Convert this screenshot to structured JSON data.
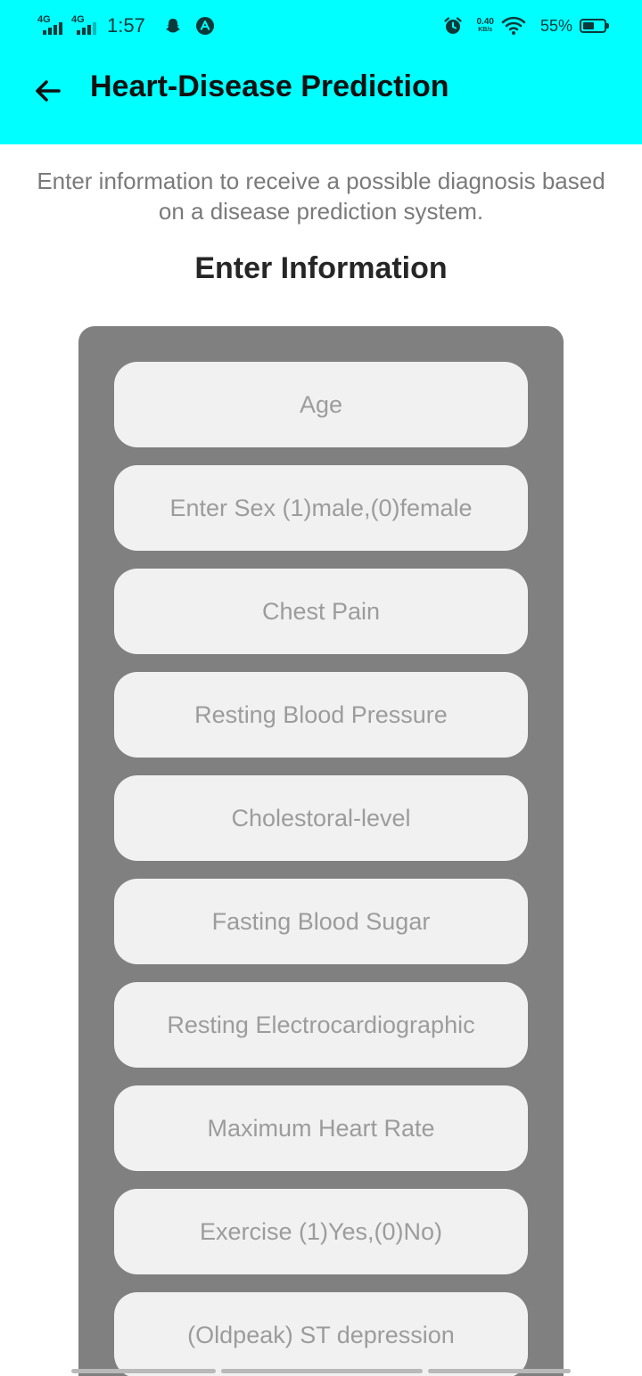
{
  "status_bar": {
    "network_1": "4G",
    "network_2": "4G",
    "time": "1:57",
    "speed_value": "0.40",
    "speed_unit": "KB/s",
    "battery_percent": "55%",
    "battery_level": 0.55,
    "icons": [
      "signal-icon",
      "snapchat-icon",
      "app-notification-icon",
      "alarm-icon",
      "wifi-icon",
      "battery-icon"
    ]
  },
  "app_bar": {
    "title": "Heart-Disease Prediction",
    "back_icon": "arrow-left-icon",
    "background": "#00ffff"
  },
  "main": {
    "intro": "Enter information to receive a possible diagnosis based on a disease prediction system.",
    "section_title": "Enter Information"
  },
  "form": {
    "card_color": "#808080",
    "fields": [
      {
        "placeholder": "Age",
        "value": ""
      },
      {
        "placeholder": "Enter Sex (1)male,(0)female",
        "value": ""
      },
      {
        "placeholder": "Chest Pain",
        "value": ""
      },
      {
        "placeholder": "Resting Blood Pressure",
        "value": ""
      },
      {
        "placeholder": "Cholestoral-level",
        "value": ""
      },
      {
        "placeholder": "Fasting Blood Sugar",
        "value": ""
      },
      {
        "placeholder": "Resting Electrocardiographic",
        "value": ""
      },
      {
        "placeholder": "Maximum Heart Rate",
        "value": ""
      },
      {
        "placeholder": "Exercise (1)Yes,(0)No)",
        "value": ""
      },
      {
        "placeholder": "(Oldpeak) ST depression",
        "value": ""
      }
    ]
  }
}
